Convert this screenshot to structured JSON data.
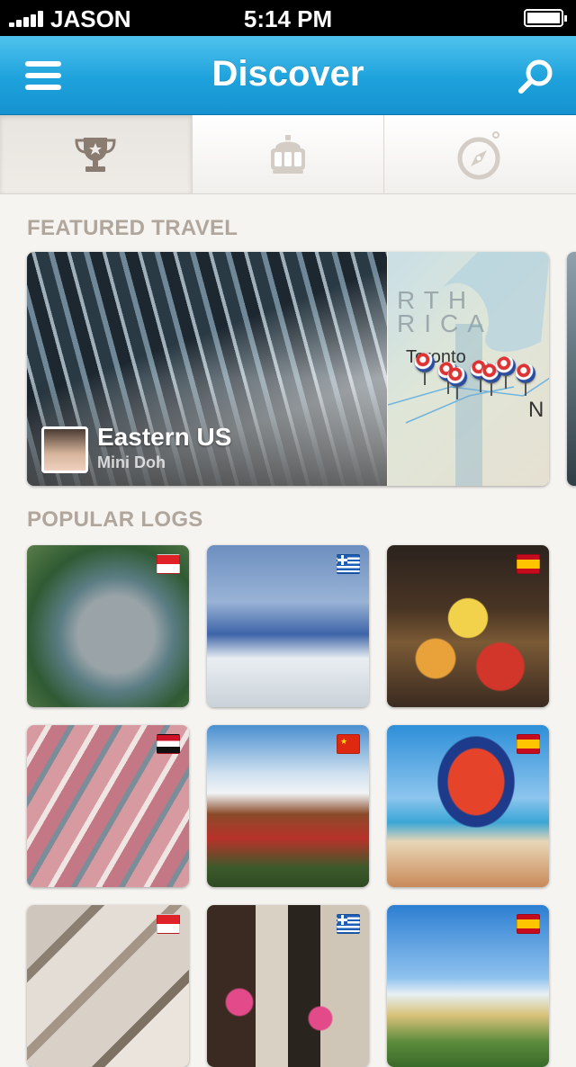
{
  "status_bar": {
    "carrier": "JASON",
    "time": "5:14 PM"
  },
  "nav": {
    "title": "Discover",
    "menu_icon": "menu-icon",
    "search_icon": "search-icon"
  },
  "tabs": [
    {
      "icon": "trophy-icon",
      "active": true
    },
    {
      "icon": "luggage-icon",
      "active": false
    },
    {
      "icon": "compass-icon",
      "active": false
    }
  ],
  "featured": {
    "section_title": "FEATURED TRAVEL",
    "title": "Eastern US",
    "author": "Mini Doh",
    "map": {
      "region_label_1": "RTH",
      "region_label_2": "RICA",
      "city": "Toronto",
      "city_2": "N"
    }
  },
  "popular": {
    "section_title": "POPULAR LOGS",
    "logs": [
      {
        "flag": "indonesia-flag"
      },
      {
        "flag": "greece-flag"
      },
      {
        "flag": "spain-flag"
      },
      {
        "flag": "syria-flag"
      },
      {
        "flag": "china-flag"
      },
      {
        "flag": "spain-flag"
      },
      {
        "flag": "indonesia-flag"
      },
      {
        "flag": "greece-flag"
      },
      {
        "flag": "spain-flag"
      }
    ]
  },
  "colors": {
    "accent": "#1ea2dc",
    "section_title": "#b0a69c",
    "background": "#f6f4f1"
  }
}
